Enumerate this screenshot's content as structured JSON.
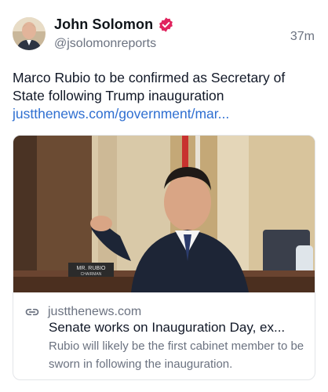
{
  "author": {
    "name": "John Solomon",
    "handle": "@jsolomonreports",
    "verified_icon": "verified-badge-icon",
    "badge_color": "#e0245e"
  },
  "timestamp": "37m",
  "post": {
    "text": "Marco Rubio to be confirmed as Secretary of State following Trump inauguration",
    "link": "justthenews.com/government/mar..."
  },
  "card": {
    "image_nameplate_line1": "MR. RUBIO",
    "image_nameplate_line2": "CHAIRMAN",
    "domain_icon": "link-icon",
    "domain": "justthenews.com",
    "title": "Senate works on Inauguration Day, ex...",
    "description": "Rubio will likely be the first cabinet member to be sworn in following the inauguration."
  },
  "colors": {
    "link": "#2f6fd1",
    "secondary_text": "#6b7280",
    "border": "#e3e5e8"
  }
}
